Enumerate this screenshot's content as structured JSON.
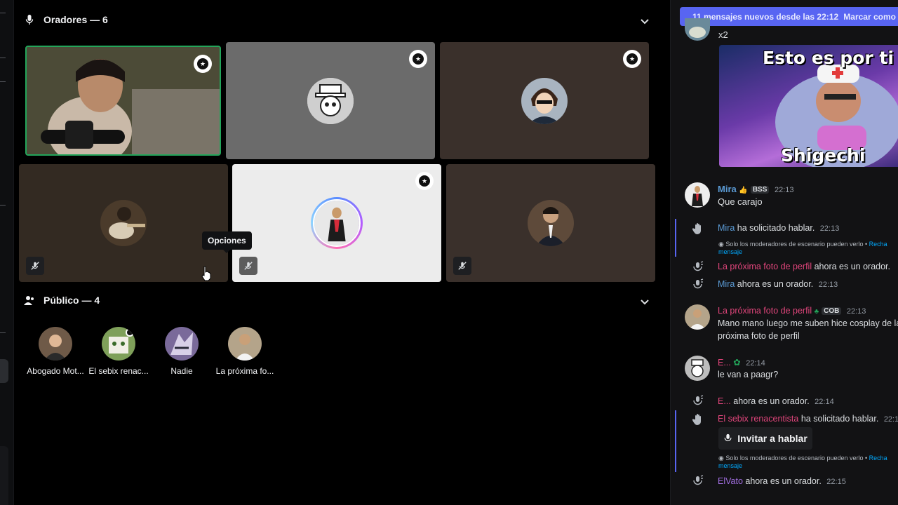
{
  "stage": {
    "speakers_header": "Oradores — 6",
    "audience_header": "Público — 4",
    "tooltip": "Opciones"
  },
  "speakers": [
    {
      "name": "speaker-webcam",
      "moderator": true,
      "muted": false,
      "bg": "#3a3a2e",
      "live": true
    },
    {
      "name": "speaker-hat",
      "moderator": true,
      "muted": false,
      "bg": "#6b6b6b"
    },
    {
      "name": "speaker-anime",
      "moderator": true,
      "muted": false,
      "bg": "#3a302b"
    },
    {
      "name": "speaker-guitar",
      "moderator": false,
      "muted": true,
      "bg": "#332a22"
    },
    {
      "name": "speaker-woman",
      "moderator": true,
      "muted": true,
      "bg": "#ececec"
    },
    {
      "name": "speaker-suit",
      "moderator": false,
      "muted": true,
      "bg": "#3a302b"
    }
  ],
  "audience": [
    {
      "name": "Abogado Mot..."
    },
    {
      "name": "El sebix renac..."
    },
    {
      "name": "Nadie"
    },
    {
      "name": "La próxima fo..."
    }
  ],
  "chat": {
    "new_messages": "11 mensajes nuevos desde las 22:12",
    "mark_read": "Marcar como",
    "x2": "x2",
    "meme_top": "Esto es por ti",
    "meme_bottom": "Shigechi",
    "msg1_user": "Mira",
    "msg1_tag": "BSS",
    "msg1_time": "22:13",
    "msg1_text": "Que carajo",
    "sys1_user": "Mira",
    "sys1_text": "ha solicitado hablar.",
    "sys1_time": "22:13",
    "mod_note": "Solo los moderadores de escenario pueden verlo •",
    "reject": "Recha",
    "mensaje": "mensaje",
    "sys2_user": "La próxima foto de perfil",
    "sys2_text": "ahora es un orador.",
    "sys3_user": "Mira",
    "sys3_text": "ahora es un orador.",
    "sys3_time": "22:13",
    "msg2_user": "La próxima foto de perfil",
    "msg2_tag": "COB",
    "msg2_time": "22:13",
    "msg2_line1": "Mano mano luego me suben hice cosplay de la",
    "msg2_line2": "próxima foto de perfil",
    "msg3_user": "E...",
    "msg3_time": "22:14",
    "msg3_text": "le van a paagr?",
    "sys4_user": "E...",
    "sys4_text": "ahora es un orador.",
    "sys4_time": "22:14",
    "sys5_user": "El sebix renacentista",
    "sys5_text": "ha solicitado hablar.",
    "sys5_time": "22:1",
    "invite": "Invitar a hablar",
    "sys6_user": "ElVato",
    "sys6_text": "ahora es un orador.",
    "sys6_time": "22:15"
  },
  "colors": {
    "mira": "#5b9bd5",
    "pink": "#e0457b",
    "purple": "#a16ee0",
    "blurple": "#5865f2"
  }
}
